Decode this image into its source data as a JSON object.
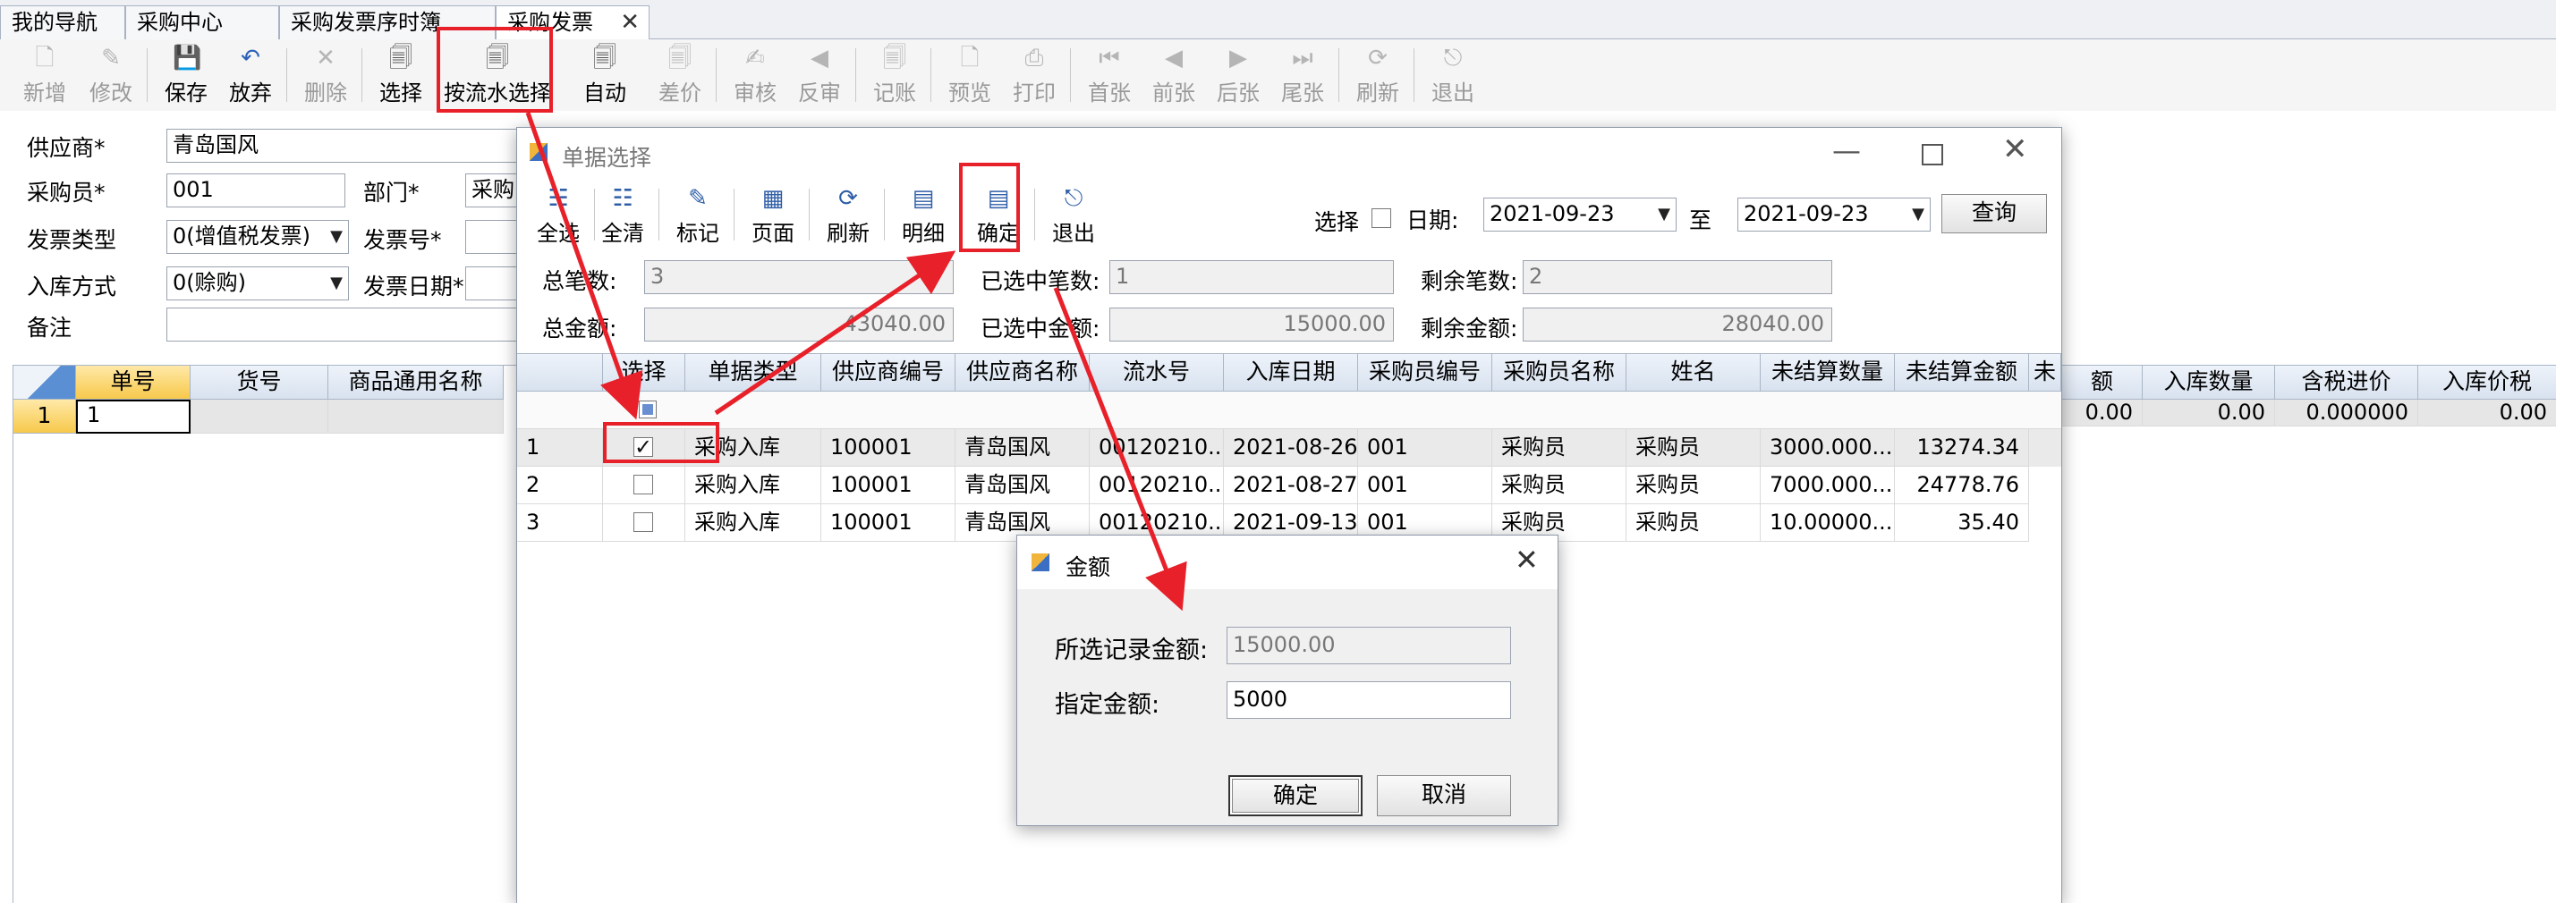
{
  "tabs": [
    {
      "label": "我的导航"
    },
    {
      "label": "采购中心"
    },
    {
      "label": "采购发票序时簿"
    },
    {
      "label": "采购发票"
    }
  ],
  "toolbar": [
    {
      "label": "新增",
      "icon": "new-doc-icon",
      "glyph": "🗋",
      "enabled": false
    },
    {
      "label": "修改",
      "icon": "edit-icon",
      "glyph": "✎",
      "enabled": false
    },
    {
      "label": "保存",
      "icon": "save-icon",
      "glyph": "💾",
      "enabled": true
    },
    {
      "label": "放弃",
      "icon": "undo-icon",
      "glyph": "↶",
      "enabled": true
    },
    {
      "label": "删除",
      "icon": "delete-icon",
      "glyph": "✕",
      "enabled": false
    },
    {
      "label": "选择",
      "icon": "select-icon",
      "glyph": "🗐",
      "enabled": true
    },
    {
      "label": "按流水选择",
      "icon": "select-by-serial-icon",
      "glyph": "🗐",
      "enabled": true
    },
    {
      "label": "自动",
      "icon": "auto-icon",
      "glyph": "🗐",
      "enabled": true
    },
    {
      "label": "差价",
      "icon": "price-diff-icon",
      "glyph": "🗐",
      "enabled": false
    },
    {
      "label": "审核",
      "icon": "audit-icon",
      "glyph": "✍",
      "enabled": false
    },
    {
      "label": "反审",
      "icon": "unaudit-icon",
      "glyph": "◀",
      "enabled": false
    },
    {
      "label": "记账",
      "icon": "post-icon",
      "glyph": "🗐",
      "enabled": false
    },
    {
      "label": "预览",
      "icon": "preview-icon",
      "glyph": "🗋",
      "enabled": false
    },
    {
      "label": "打印",
      "icon": "print-icon",
      "glyph": "⎙",
      "enabled": false
    },
    {
      "label": "首张",
      "icon": "first-icon",
      "glyph": "⏮",
      "enabled": false
    },
    {
      "label": "前张",
      "icon": "prev-icon",
      "glyph": "◀",
      "enabled": false
    },
    {
      "label": "后张",
      "icon": "next-icon",
      "glyph": "▶",
      "enabled": false
    },
    {
      "label": "尾张",
      "icon": "last-icon",
      "glyph": "⏭",
      "enabled": false
    },
    {
      "label": "刷新",
      "icon": "refresh-icon",
      "glyph": "⟳",
      "enabled": false
    },
    {
      "label": "退出",
      "icon": "exit-icon",
      "glyph": "⎋",
      "enabled": false
    }
  ],
  "form": {
    "supplier_label": "供应商*",
    "supplier_value": "青岛国风",
    "buyer_label": "采购员*",
    "buyer_value": "001",
    "dept_label": "部门*",
    "dept_value": "采购",
    "invoice_type_label": "发票类型",
    "invoice_type_value": "0(增值税发票)",
    "invoice_no_label": "发票号*",
    "in_method_label": "入库方式",
    "in_method_value": "0(赊购)",
    "invoice_date_label": "发票日期*",
    "note_label": "备注"
  },
  "main_grid": {
    "headers": [
      "单号",
      "货号",
      "商品通用名称"
    ],
    "right_headers": [
      "额",
      "入库数量",
      "含税进价",
      "入库价税"
    ],
    "row_num": "1",
    "row_cell": "1",
    "right_values": [
      "0.00",
      "0.00",
      "0.000000",
      "0.00"
    ]
  },
  "selection_window": {
    "title": "单据选择",
    "toolbar": [
      {
        "label": "全选",
        "icon": "select-all-icon",
        "glyph": "☷"
      },
      {
        "label": "全清",
        "icon": "clear-all-icon",
        "glyph": "☷"
      },
      {
        "label": "标记",
        "icon": "mark-icon",
        "glyph": "✎"
      },
      {
        "label": "页面",
        "icon": "page-icon",
        "glyph": "▦"
      },
      {
        "label": "刷新",
        "icon": "refresh-icon",
        "glyph": "⟳"
      },
      {
        "label": "明细",
        "icon": "detail-icon",
        "glyph": "▤"
      },
      {
        "label": "确定",
        "icon": "confirm-icon",
        "glyph": "▤"
      },
      {
        "label": "退出",
        "icon": "exit-icon",
        "glyph": "⎋"
      }
    ],
    "select_label": "选择",
    "date_label": "日期:",
    "date_from": "2021-09-23",
    "date_to_label": "至",
    "date_to": "2021-09-23",
    "query_label": "查询",
    "total_count_label": "总笔数:",
    "total_count": "3",
    "selected_count_label": "已选中笔数:",
    "selected_count": "1",
    "remain_count_label": "剩余笔数:",
    "remain_count": "2",
    "total_amount_label": "总金额:",
    "total_amount": "43040.00",
    "selected_amount_label": "已选中金额:",
    "selected_amount": "15000.00",
    "remain_amount_label": "剩余金额:",
    "remain_amount": "28040.00",
    "headers": [
      "选择",
      "单据类型",
      "供应商编号",
      "供应商名称",
      "流水号",
      "入库日期",
      "采购员编号",
      "采购员名称",
      "姓名",
      "未结算数量",
      "未结算金额",
      "未"
    ],
    "rows": [
      {
        "num": "1",
        "checked": true,
        "type": "采购入库",
        "supplier_no": "100001",
        "supplier_name": "青岛国风",
        "serial": "00120210...",
        "date": "2021-08-26",
        "buyer_no": "001",
        "buyer_name": "采购员",
        "name": "采购员",
        "qty": "3000.000...",
        "amount": "13274.34"
      },
      {
        "num": "2",
        "checked": false,
        "type": "采购入库",
        "supplier_no": "100001",
        "supplier_name": "青岛国风",
        "serial": "00120210...",
        "date": "2021-08-27",
        "buyer_no": "001",
        "buyer_name": "采购员",
        "name": "采购员",
        "qty": "7000.000...",
        "amount": "24778.76"
      },
      {
        "num": "3",
        "checked": false,
        "type": "采购入库",
        "supplier_no": "100001",
        "supplier_name": "青岛国风",
        "serial": "00120210...",
        "date": "2021-09-13",
        "buyer_no": "001",
        "buyer_name": "采购员",
        "name": "采购员",
        "qty": "10.00000...",
        "amount": "35.40"
      }
    ]
  },
  "amount_dialog": {
    "title": "金额",
    "selected_label": "所选记录金额:",
    "selected_value": "15000.00",
    "specified_label": "指定金额:",
    "specified_value": "5000",
    "ok_label": "确定",
    "cancel_label": "取消"
  },
  "colors": {
    "annotation_red": "#e8202a",
    "grid_header": "#dce6f2"
  }
}
